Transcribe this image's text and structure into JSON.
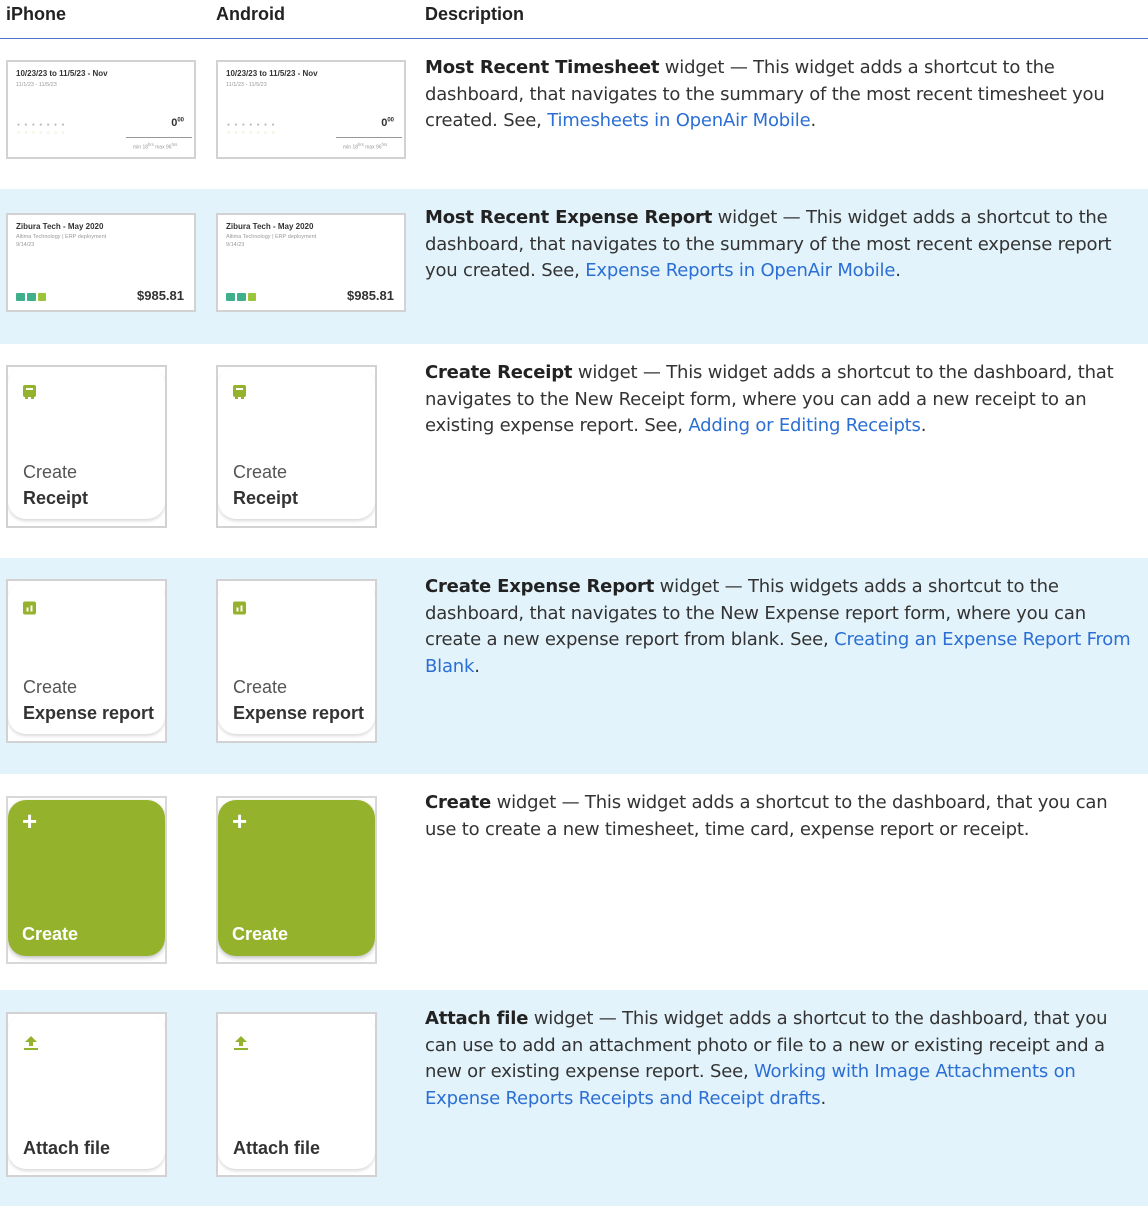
{
  "headers": {
    "iphone": "iPhone",
    "android": "Android",
    "description": "Description"
  },
  "rows": [
    {
      "card": {
        "title": "10/23/23 to 11/5/23 - Nov",
        "subtitle": "11/1/23 - 11/5/23",
        "amount": "0",
        "amount_sup": "00",
        "stat1": "min 18",
        "stat1_unit": "hrs",
        "stat2": "max 96",
        "stat2_unit": "hrs"
      },
      "desc": {
        "bold": "Most Recent Timesheet",
        "text": " widget — This widget adds a shortcut to the dashboard, that navigates to the summary of the most recent timesheet you created. See, ",
        "link": "Timesheets in OpenAir Mobile",
        "end": "."
      }
    },
    {
      "card": {
        "title": "Zibura Tech - May 2020",
        "subtitle": "Altima Technology | ERP deployment",
        "date": "9/14/23",
        "amount": "$985.81"
      },
      "desc": {
        "bold": "Most Recent Expense Report",
        "text": " widget — This widget adds a shortcut to the dashboard, that navigates to the summary of the most recent expense report you created. See, ",
        "link": "Expense Reports in OpenAir Mobile",
        "end": "."
      }
    },
    {
      "card": {
        "line1": "Create",
        "line2": "Receipt",
        "icon": "receipt-icon"
      },
      "desc": {
        "bold": "Create Receipt",
        "text": " widget — This widget adds a shortcut to the dashboard, that navigates to the New Receipt form, where you can add a new receipt to an existing expense report. See, ",
        "link": "Adding or Editing Receipts",
        "end": "."
      }
    },
    {
      "card": {
        "line1": "Create",
        "line2": "Expense report",
        "icon": "expense-report-icon"
      },
      "desc": {
        "bold": "Create Expense Report",
        "text": " widget — This widgets adds a shortcut to the dashboard, that navigates to the New Expense report form, where you can create a new expense report from blank. See, ",
        "link": "Creating an Expense Report From Blank",
        "end": "."
      }
    },
    {
      "card": {
        "line1": "+",
        "line2": "Create",
        "icon": "plus-icon"
      },
      "desc": {
        "bold": "Create",
        "text": " widget — This widget adds a shortcut to the dashboard, that you can use to create a new timesheet, time card, expense report or receipt.",
        "link": "",
        "end": ""
      }
    },
    {
      "card": {
        "line1": "Attach file",
        "icon": "upload-icon"
      },
      "desc": {
        "bold": "Attach file",
        "text": " widget — This widget adds a shortcut to the dashboard, that you can use to add an attachment photo or file to a new or existing receipt and a new or existing expense report. See, ",
        "link": "Working with Image Attachments on Expense Reports Receipts and Receipt drafts",
        "end": "."
      }
    }
  ],
  "colors": {
    "accent_green": "#95b22c",
    "row_highlight": "#e3f3fb",
    "link": "#2b6fd4"
  }
}
